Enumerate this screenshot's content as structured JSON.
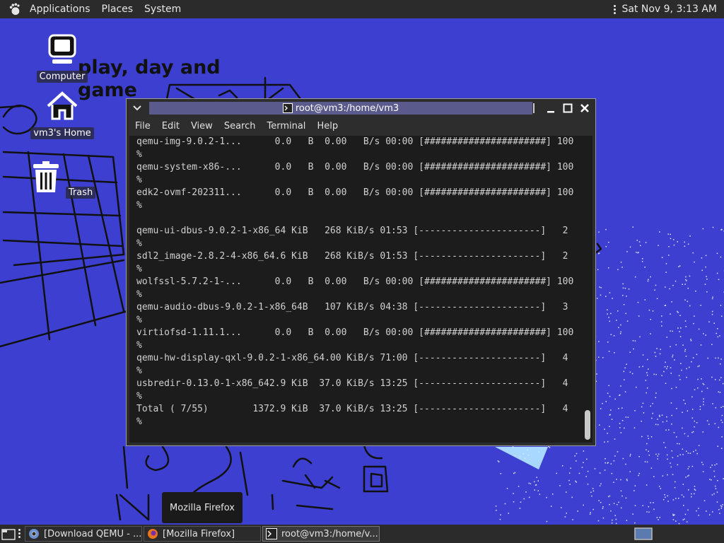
{
  "top_panel": {
    "menus": [
      "Applications",
      "Places",
      "System"
    ],
    "clock": "Sat Nov 9,  3:13 AM"
  },
  "desktop": {
    "icons": [
      {
        "label": "Computer",
        "icon": "computer-icon"
      },
      {
        "label": "vm3's Home",
        "icon": "home-folder-icon"
      },
      {
        "label": "Trash",
        "icon": "trash-icon"
      }
    ],
    "wallpaper_text": [
      "play, day and",
      "game"
    ]
  },
  "terminal": {
    "title": "root@vm3:/home/vm3",
    "menu": [
      "File",
      "Edit",
      "View",
      "Search",
      "Terminal",
      "Help"
    ],
    "lines": [
      "qemu-img-9.0.2-1...      0.0   B  0.00   B/s 00:00 [######################] 100",
      "%",
      "qemu-system-x86-...      0.0   B  0.00   B/s 00:00 [######################] 100",
      "%",
      "edk2-ovmf-202311...      0.0   B  0.00   B/s 00:00 [######################] 100",
      "%",
      "",
      "qemu-ui-dbus-9.0.2-1-x86_64 KiB   268 KiB/s 01:53 [----------------------]   2",
      "%",
      "sdl2_image-2.8.2-4-x86_64.6 KiB   268 KiB/s 01:53 [----------------------]   2",
      "%",
      "wolfssl-5.7.2-1-...      0.0   B  0.00   B/s 00:00 [######################] 100",
      "%",
      "qemu-audio-dbus-9.0.2-1-x86_64B   107 KiB/s 04:38 [----------------------]   3",
      "%",
      "virtiofsd-1.11.1...      0.0   B  0.00   B/s 00:00 [######################] 100",
      "%",
      "qemu-hw-display-qxl-9.0.2-1-x86_64.00 KiB/s 71:00 [----------------------]   4",
      "%",
      "usbredir-0.13.0-1-x86_642.9 KiB  37.0 KiB/s 13:25 [----------------------]   4",
      "%",
      "Total ( 7/55)        1372.9 KiB  37.0 KiB/s 13:25 [----------------------]   4",
      "%"
    ]
  },
  "tooltip": "Mozilla Firefox",
  "taskbar": {
    "tasks": [
      {
        "label": "[Download QEMU - ...",
        "icon": "chromium-icon"
      },
      {
        "label": "[Mozilla Firefox]",
        "icon": "firefox-icon"
      },
      {
        "label": "root@vm3:/home/v...",
        "icon": "terminal-icon"
      }
    ]
  },
  "colors": {
    "desktop_bg": "#3d3fd0",
    "panel_bg": "#2b2b2b",
    "terminal_bg": "#1c1c1c",
    "title_active": "#5a5a8c"
  }
}
